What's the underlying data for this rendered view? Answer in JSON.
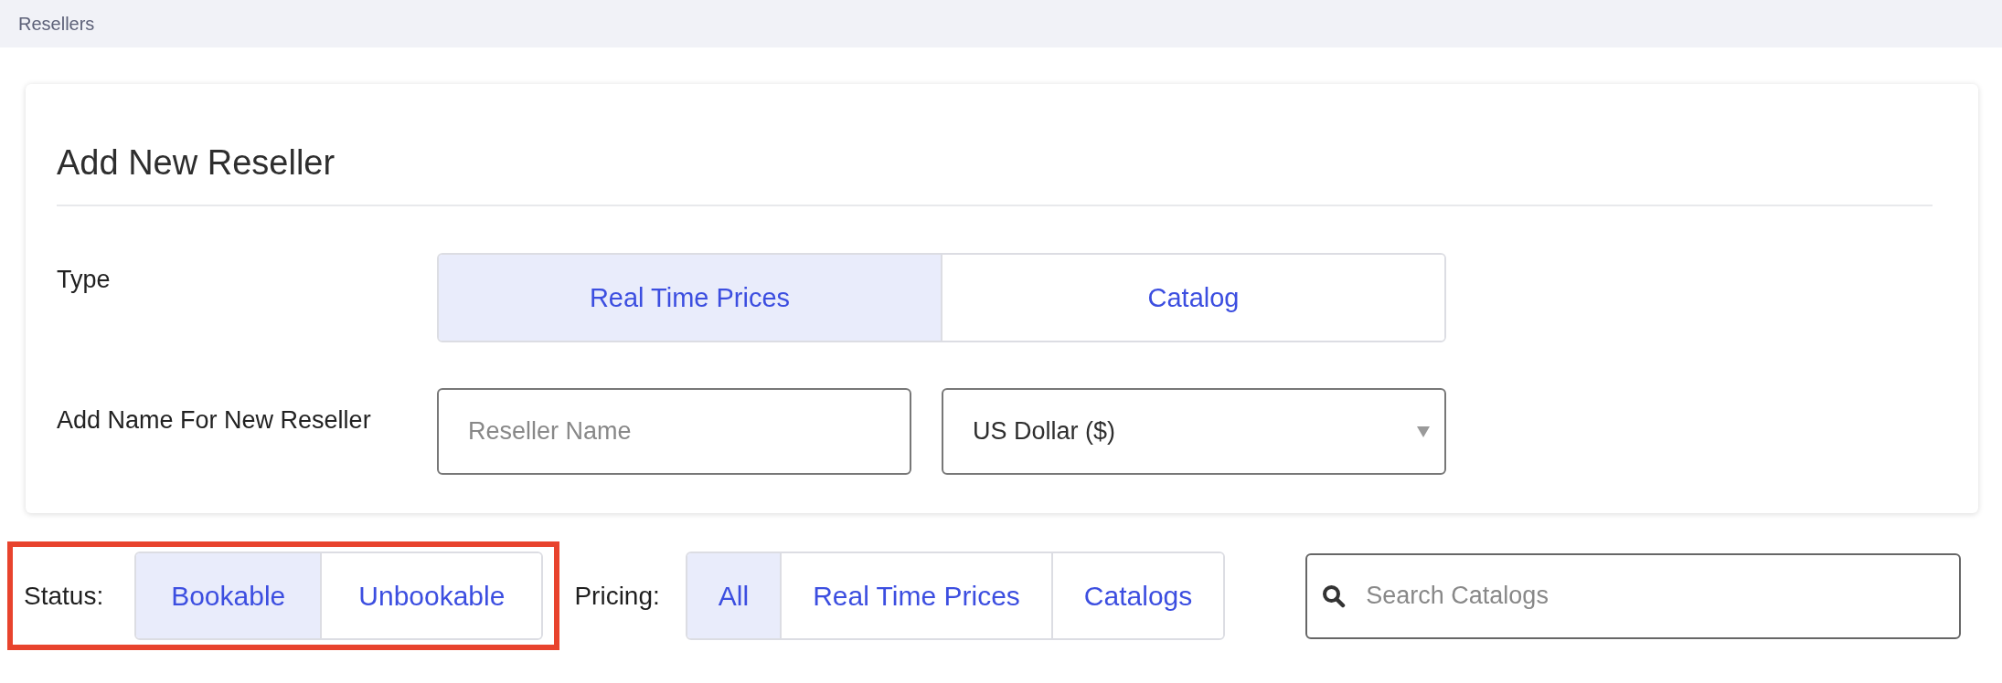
{
  "breadcrumb": "Resellers",
  "form": {
    "title": "Add New Reseller",
    "type": {
      "label": "Type",
      "options": [
        {
          "label": "Real Time Prices",
          "selected": true
        },
        {
          "label": "Catalog",
          "selected": false
        }
      ]
    },
    "name": {
      "label": "Add Name For New Reseller",
      "placeholder": "Reseller Name",
      "currency": "US Dollar ($)"
    }
  },
  "filters": {
    "status": {
      "label": "Status:",
      "highlighted": true,
      "options": [
        {
          "label": "Bookable",
          "selected": true
        },
        {
          "label": "Unbookable",
          "selected": false
        }
      ]
    },
    "pricing": {
      "label": "Pricing:",
      "options": [
        {
          "label": "All",
          "selected": true
        },
        {
          "label": "Real Time Prices",
          "selected": false
        },
        {
          "label": "Catalogs",
          "selected": false
        }
      ]
    },
    "search": {
      "placeholder": "Search Catalogs"
    }
  }
}
